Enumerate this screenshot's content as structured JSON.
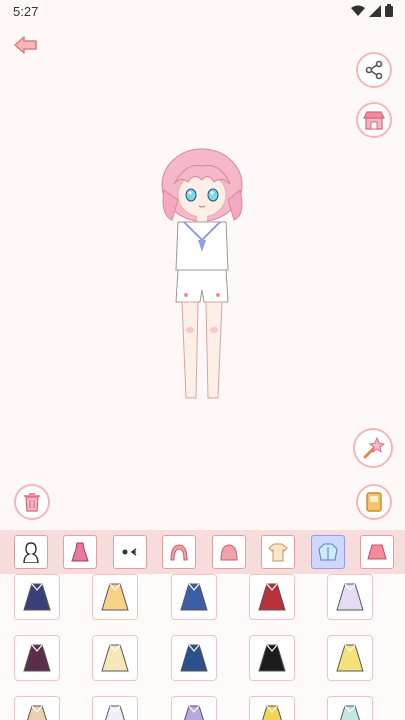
{
  "status_bar": {
    "time": "5:27",
    "icons": [
      "wifi-icon",
      "signal-icon",
      "battery-icon"
    ]
  },
  "toolbar": {
    "back_icon": "back-arrow-icon"
  },
  "side_actions": {
    "right": [
      "share-icon",
      "shop-icon",
      "magic-wand-icon",
      "save-card-icon"
    ],
    "left": [
      "trash-icon"
    ]
  },
  "categories": [
    {
      "id": "body",
      "icon": "body-silhouette-icon"
    },
    {
      "id": "dress",
      "icon": "dress-icon"
    },
    {
      "id": "face",
      "icon": "face-expression-icon"
    },
    {
      "id": "hair-back",
      "icon": "hair-back-icon"
    },
    {
      "id": "hair-front",
      "icon": "hair-front-icon"
    },
    {
      "id": "shirt",
      "icon": "shirt-icon"
    },
    {
      "id": "jacket",
      "icon": "jacket-icon",
      "selected": true
    },
    {
      "id": "skirt",
      "icon": "skirt-icon"
    }
  ],
  "items": [
    {
      "icon": "navy-dress-icon",
      "color": "#3a3f7a"
    },
    {
      "icon": "yellow-dress-icon",
      "color": "#f5d48a"
    },
    {
      "icon": "blue-armor-icon",
      "color": "#3d5fa8"
    },
    {
      "icon": "red-robe-icon",
      "color": "#b7313a"
    },
    {
      "icon": "lavender-gown-icon",
      "color": "#e5dcf3"
    },
    {
      "icon": "dark-gothic-dress-icon",
      "color": "#5a2d4a"
    },
    {
      "icon": "cream-dress-icon",
      "color": "#f7e7b8"
    },
    {
      "icon": "blue-jacket-icon",
      "color": "#2d4f8a"
    },
    {
      "icon": "black-red-hoodie-icon",
      "color": "#1c1c1c"
    },
    {
      "icon": "yellow-bunny-outfit-icon",
      "color": "#f5e07a"
    },
    {
      "icon": "beige-coat-icon",
      "color": "#e8d0b0"
    },
    {
      "icon": "white-lace-dress-icon",
      "color": "#f0eef8"
    },
    {
      "icon": "purple-outfit-icon",
      "color": "#b8a8e0"
    },
    {
      "icon": "gold-outfit-icon",
      "color": "#f2d45a"
    },
    {
      "icon": "mint-outfit-icon",
      "color": "#bfe8e0"
    }
  ],
  "colors": {
    "accent": "#f2b8b8",
    "tab_bg": "#f7dcdc",
    "selected": "#cfd6ff"
  }
}
